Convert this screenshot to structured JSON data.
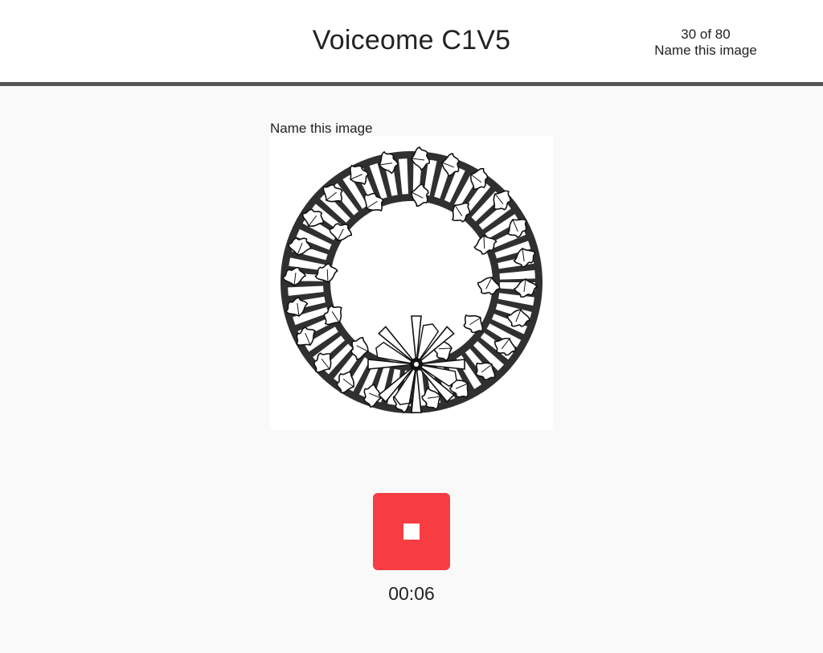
{
  "header": {
    "title": "Voiceome C1V5",
    "progress_count": "30 of 80",
    "task_name": "Name this image"
  },
  "task": {
    "prompt": "Name this image",
    "image_subject": "wreath-illustration"
  },
  "recorder": {
    "button_icon": "stop-icon",
    "button_color": "#f83d42",
    "elapsed": "00:06"
  }
}
